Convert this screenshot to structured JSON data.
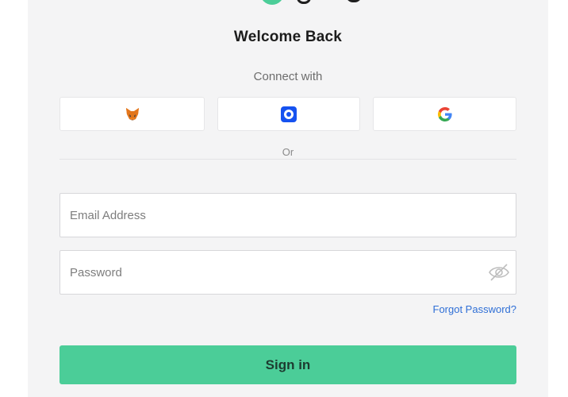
{
  "header": {
    "title": "Welcome Back"
  },
  "connect": {
    "label": "Connect with",
    "providers": [
      {
        "name": "metamask",
        "icon": "metamask-fox-icon"
      },
      {
        "name": "coinbase",
        "icon": "coinbase-icon"
      },
      {
        "name": "google",
        "icon": "google-icon"
      }
    ]
  },
  "divider": {
    "text": "Or"
  },
  "form": {
    "email_placeholder": "Email Address",
    "email_value": "",
    "password_placeholder": "Password",
    "password_value": "",
    "forgot_label": "Forgot Password?",
    "signin_label": "Sign in"
  },
  "colors": {
    "accent": "#4bcd98",
    "link": "#2f6fd6",
    "card_bg": "#f4f4f5"
  }
}
